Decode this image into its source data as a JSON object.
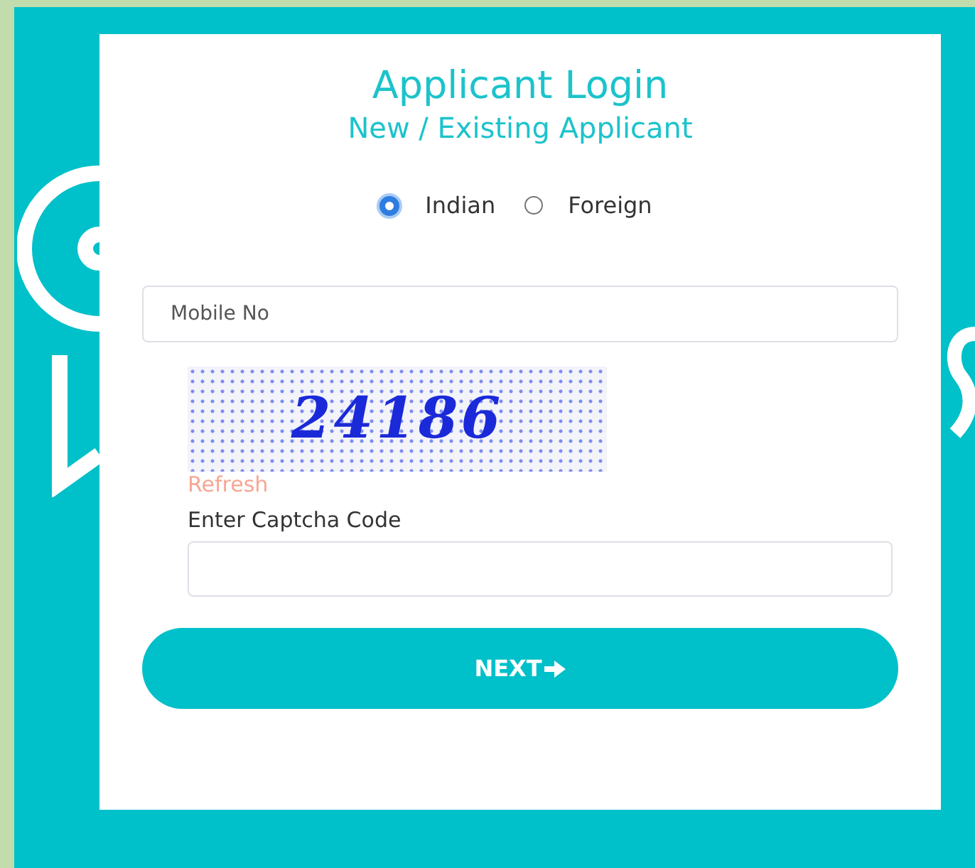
{
  "title": "Applicant Login",
  "subtitle": "New / Existing Applicant",
  "nationality": [
    {
      "label": "Indian",
      "selected": true
    },
    {
      "label": "Foreign",
      "selected": false
    }
  ],
  "mobile_field": {
    "placeholder": "Mobile No"
  },
  "captcha": {
    "code": "24186",
    "refresh": "Refresh",
    "label": "Enter Captcha Code"
  },
  "next_button": {
    "label": "NEXT"
  }
}
